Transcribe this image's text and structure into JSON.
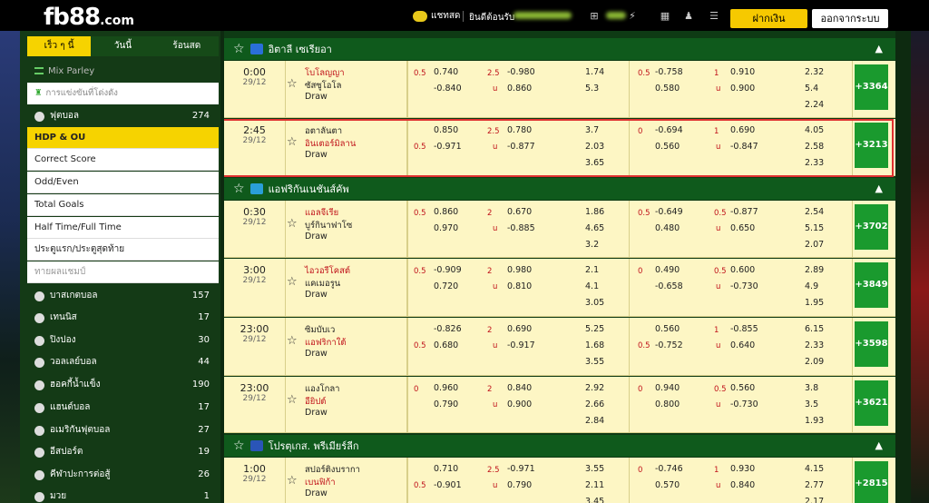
{
  "header": {
    "logo_main": "fb88",
    "logo_suffix": ".com",
    "chat_label": "แชทสด",
    "user_label": "ยินดีต้อนรับ",
    "deposit_label": "ฝากเงิน",
    "logout_label": "ออกจากระบบ"
  },
  "sidebar": {
    "tabs": [
      "เร็ว ๆ นี้",
      "วันนี้",
      "ร้อนสด"
    ],
    "mix_label": "Mix Parley",
    "search_placeholder": "การแข่งขันที่โด่งดัง",
    "football": {
      "label": "ฟุตบอล",
      "count": "274"
    },
    "subs": [
      "HDP & OU",
      "Correct Score",
      "Odd/Even",
      "Total Goals",
      "Half Time/Full Time",
      "ประตูแรก/ประตูสุดท้าย",
      "ทายผลแชมป์"
    ],
    "sports": [
      {
        "label": "บาสเกตบอล",
        "count": "157"
      },
      {
        "label": "เทนนิส",
        "count": "17"
      },
      {
        "label": "ปิงปอง",
        "count": "30"
      },
      {
        "label": "วอลเลย์บอล",
        "count": "44"
      },
      {
        "label": "ฮอคกี้น้ำแข็ง",
        "count": "190"
      },
      {
        "label": "แฮนด์บอล",
        "count": "17"
      },
      {
        "label": "อเมริกันฟุตบอล",
        "count": "27"
      },
      {
        "label": "อีสปอร์ต",
        "count": "19"
      },
      {
        "label": "คีฬาปะการต่อสู้",
        "count": "26"
      },
      {
        "label": "มวย",
        "count": "1"
      }
    ]
  },
  "leagues": [
    {
      "name": "อิตาลี เซเรียอา",
      "flag_color": "#2a6fd8"
    },
    {
      "name": "แอฟริกันเนชันส์คัพ",
      "flag_color": "#2a9fd8"
    },
    {
      "name": "โปรตุเกส. พรีเมียร์ลีก",
      "flag_color": "#2a55b8"
    }
  ],
  "matches": [
    {
      "time": "0:00",
      "date": "29/12",
      "home": "โบโลญญา",
      "away": "ซัสซูโอโล",
      "draw": "Draw",
      "home_red": true,
      "away_red": false,
      "hdp_line1": "0.5",
      "hdp1": "0.740",
      "hdp2": "-0.840",
      "ou_line": "2.5",
      "ou_u": "u",
      "ou1": "-0.980",
      "ou2": "0.860",
      "x1": "1.74",
      "x2": "5.3",
      "x3": "",
      "h_line1": "0.5",
      "h1": "-0.758",
      "h2": "0.580",
      "h_ou_line": "1",
      "h_ou_u": "u",
      "h_ou1": "0.910",
      "h_ou2": "0.900",
      "hx1": "2.32",
      "hx2": "5.4",
      "hx3": "2.24",
      "more": "+3364"
    },
    {
      "time": "2:45",
      "date": "29/12",
      "home": "อตาลันตา",
      "away": "อินเตอร์มิลาน",
      "draw": "Draw",
      "home_red": false,
      "away_red": true,
      "hdp_line2": "0.5",
      "hdp1": "0.850",
      "hdp2": "-0.971",
      "ou_line": "2.5",
      "ou_u": "u",
      "ou1": "0.780",
      "ou2": "-0.877",
      "x1": "3.7",
      "x2": "2.03",
      "x3": "3.65",
      "h_line1": "0",
      "h1": "-0.694",
      "h2": "0.560",
      "h_ou_line": "1",
      "h_ou_u": "u",
      "h_ou1": "0.690",
      "h_ou2": "-0.847",
      "hx1": "4.05",
      "hx2": "2.58",
      "hx3": "2.33",
      "more": "+3213"
    },
    {
      "time": "0:30",
      "date": "29/12",
      "home": "แอลจีเรีย",
      "away": "บูร์กินาฟาโซ",
      "draw": "Draw",
      "home_red": true,
      "away_red": false,
      "hdp_line1": "0.5",
      "hdp1": "0.860",
      "hdp2": "0.970",
      "ou_line": "2",
      "ou_u": "u",
      "ou1": "0.670",
      "ou2": "-0.885",
      "x1": "1.86",
      "x2": "4.65",
      "x3": "3.2",
      "h_line1": "0.5",
      "h1": "-0.649",
      "h2": "0.480",
      "h_ou_line": "0.5",
      "h_ou_u": "u",
      "h_ou1": "-0.877",
      "h_ou2": "0.650",
      "hx1": "2.54",
      "hx2": "5.15",
      "hx3": "2.07",
      "more": "+3702"
    },
    {
      "time": "3:00",
      "date": "29/12",
      "home": "ไอวอรีโคสต์",
      "away": "แคเมอรูน",
      "draw": "Draw",
      "home_red": true,
      "away_red": false,
      "hdp_line1": "0.5",
      "hdp1": "-0.909",
      "hdp2": "0.720",
      "ou_line": "2",
      "ou_u": "u",
      "ou1": "0.980",
      "ou2": "0.810",
      "x1": "2.1",
      "x2": "4.1",
      "x3": "3.05",
      "h_line1": "0",
      "h1": "0.490",
      "h2": "-0.658",
      "h_ou_line": "0.5",
      "h_ou_u": "u",
      "h_ou1": "0.600",
      "h_ou2": "-0.730",
      "hx1": "2.89",
      "hx2": "4.9",
      "hx3": "1.95",
      "more": "+3849"
    },
    {
      "time": "23:00",
      "date": "29/12",
      "home": "ซิมบับเว",
      "away": "แอฟริกาใต้",
      "draw": "Draw",
      "home_red": false,
      "away_red": true,
      "hdp_line2": "0.5",
      "hdp1": "-0.826",
      "hdp2": "0.680",
      "ou_line": "2",
      "ou_u": "u",
      "ou1": "0.690",
      "ou2": "-0.917",
      "x1": "5.25",
      "x2": "1.68",
      "x3": "3.55",
      "h_line2": "0.5",
      "h1": "0.560",
      "h2": "-0.752",
      "h_ou_line": "1",
      "h_ou_u": "u",
      "h_ou1": "-0.855",
      "h_ou2": "0.640",
      "hx1": "6.15",
      "hx2": "2.33",
      "hx3": "2.09",
      "more": "+3598"
    },
    {
      "time": "23:00",
      "date": "29/12",
      "home": "แองโกลา",
      "away": "อียิปต์",
      "draw": "Draw",
      "home_red": false,
      "away_red": true,
      "hdp_line1": "0",
      "hdp1": "0.960",
      "hdp2": "0.790",
      "ou_line": "2",
      "ou_u": "u",
      "ou1": "0.840",
      "ou2": "0.900",
      "x1": "2.92",
      "x2": "2.66",
      "x3": "2.84",
      "h_line1": "0",
      "h1": "0.940",
      "h2": "0.800",
      "h_ou_line": "0.5",
      "h_ou_u": "u",
      "h_ou1": "0.560",
      "h_ou2": "-0.730",
      "hx1": "3.8",
      "hx2": "3.5",
      "hx3": "1.93",
      "more": "+3621"
    },
    {
      "time": "1:00",
      "date": "29/12",
      "home": "สปอร์ติงบรากา",
      "away": "เบนฟิก้า",
      "draw": "Draw",
      "home_red": false,
      "away_red": true,
      "hdp_line2": "0.5",
      "hdp1": "0.710",
      "hdp2": "-0.901",
      "ou_line": "2.5",
      "ou_u": "u",
      "ou1": "-0.971",
      "ou2": "0.790",
      "x1": "3.55",
      "x2": "2.11",
      "x3": "3.45",
      "h_line1": "0",
      "h1": "-0.746",
      "h2": "0.570",
      "h_ou_line": "1",
      "h_ou_u": "u",
      "h_ou1": "0.930",
      "h_ou2": "0.840",
      "hx1": "4.15",
      "hx2": "2.77",
      "hx3": "2.17",
      "more": "+2815"
    }
  ]
}
